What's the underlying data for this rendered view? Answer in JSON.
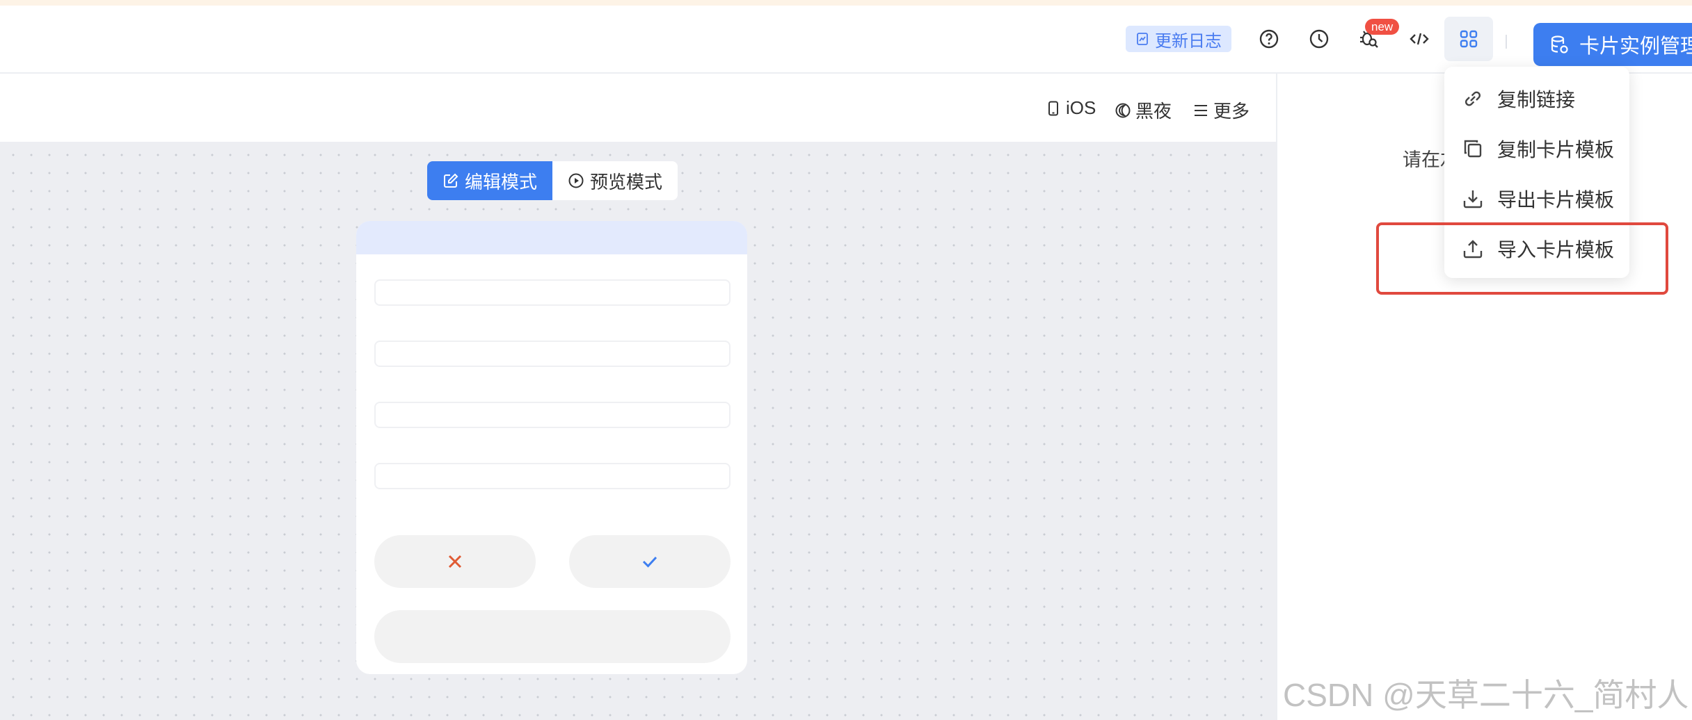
{
  "header": {
    "changelog_label": "更新日志",
    "new_badge": "new",
    "manage_label": "卡片实例管理"
  },
  "subbar": {
    "device": "iOS",
    "theme": "黑夜",
    "more": "更多"
  },
  "mode_switch": {
    "edit": "编辑模式",
    "preview": "预览模式"
  },
  "panel": {
    "hint": "请在左侧选择组件"
  },
  "menu": {
    "items": [
      {
        "label": "复制链接",
        "icon": "link-icon"
      },
      {
        "label": "复制卡片模板",
        "icon": "copy-icon"
      },
      {
        "label": "导出卡片模板",
        "icon": "download-icon"
      },
      {
        "label": "导入卡片模板",
        "icon": "upload-icon"
      }
    ]
  },
  "watermark": "CSDN @天草二十六_简村人",
  "colors": {
    "accent": "#3d7ef0",
    "badge": "#f05043",
    "highlight": "#e0493e",
    "cancel": "#e05a33"
  }
}
